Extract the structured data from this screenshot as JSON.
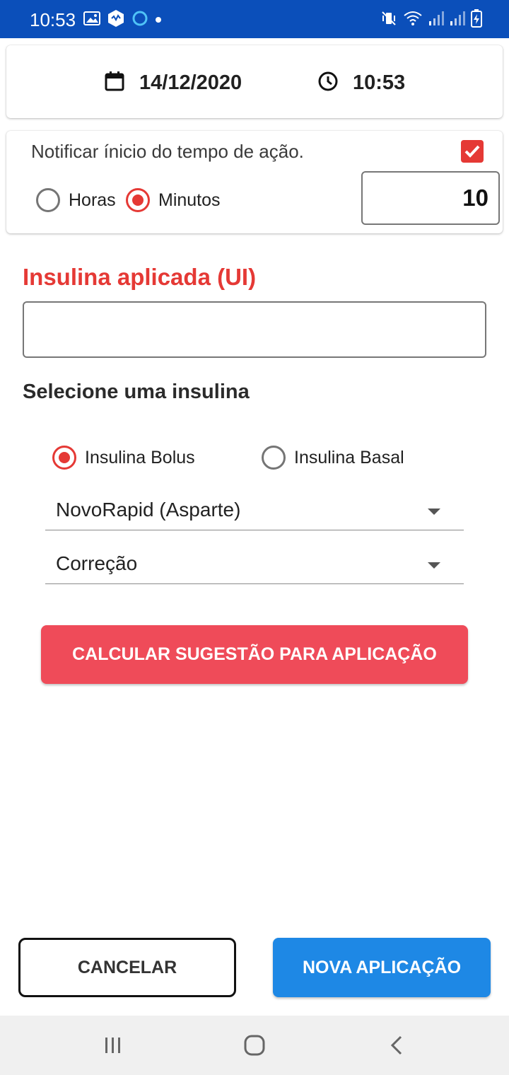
{
  "status_bar": {
    "time": "10:53",
    "left_icons": [
      "image-icon",
      "app-hex-icon",
      "circle-icon",
      "dot-icon"
    ],
    "right_icons": [
      "vibrate-mute-icon",
      "wifi-icon",
      "signal-icon",
      "signal-icon",
      "battery-charging-icon"
    ]
  },
  "datetime": {
    "date": "14/12/2020",
    "time": "10:53"
  },
  "notify": {
    "label": "Notificar ínicio do tempo de ação.",
    "checked": true,
    "unit_hours_label": "Horas",
    "unit_minutes_label": "Minutos",
    "selected_unit": "Minutos",
    "value": "10"
  },
  "insulin_applied": {
    "title": "Insulina aplicada (UI)",
    "value": ""
  },
  "select_insulin": {
    "title": "Selecione uma insulina",
    "bolus_label": "Insulina Bolus",
    "basal_label": "Insulina Basal",
    "selected": "Insulina Bolus",
    "insulin_dropdown": "NovoRapid (Asparte)",
    "type_dropdown": "Correção"
  },
  "buttons": {
    "calculate": "CALCULAR SUGESTÃO PARA APLICAÇÃO",
    "cancel": "CANCELAR",
    "new_application": "NOVA APLICAÇÃO"
  },
  "colors": {
    "status_bar": "#0b4fba",
    "accent_red": "#e53935",
    "calc_button": "#ef4b59",
    "primary_blue": "#1e88e5"
  }
}
